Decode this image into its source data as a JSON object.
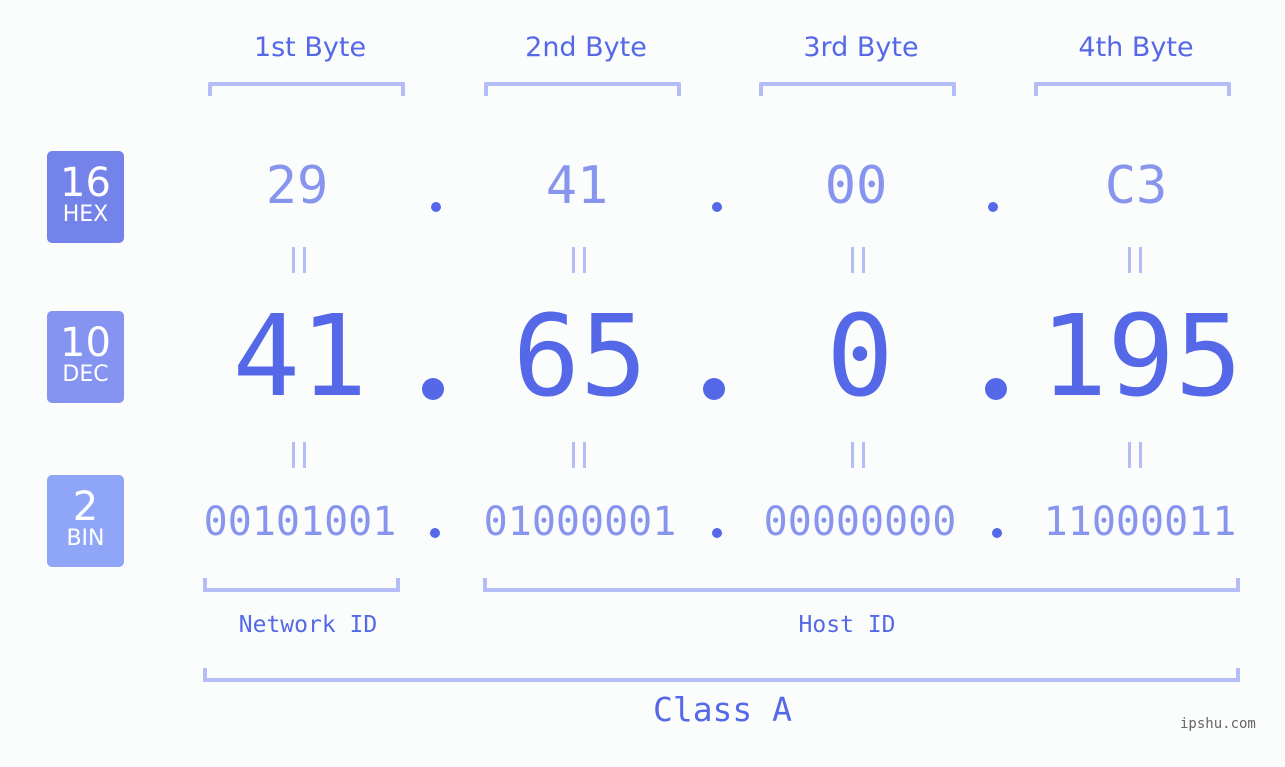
{
  "header": {
    "bytes": [
      "1st Byte",
      "2nd Byte",
      "3rd Byte",
      "4th Byte"
    ]
  },
  "badges": [
    {
      "num": "16",
      "label": "HEX",
      "color": "#7383ea"
    },
    {
      "num": "10",
      "label": "DEC",
      "color": "#8593f1"
    },
    {
      "num": "2",
      "label": "BIN",
      "color": "#8fa6f8"
    }
  ],
  "hex": [
    "29",
    "41",
    "00",
    "C3"
  ],
  "dec": [
    "41",
    "65",
    "0",
    "195"
  ],
  "bin": [
    "00101001",
    "01000001",
    "00000000",
    "11000011"
  ],
  "ids": {
    "network": "Network ID",
    "host": "Host ID"
  },
  "class_label": "Class A",
  "watermark": "ipshu.com",
  "colors": {
    "accent": "#5468e8",
    "light": "#8895ee",
    "bracket": "#b4bdf7"
  }
}
